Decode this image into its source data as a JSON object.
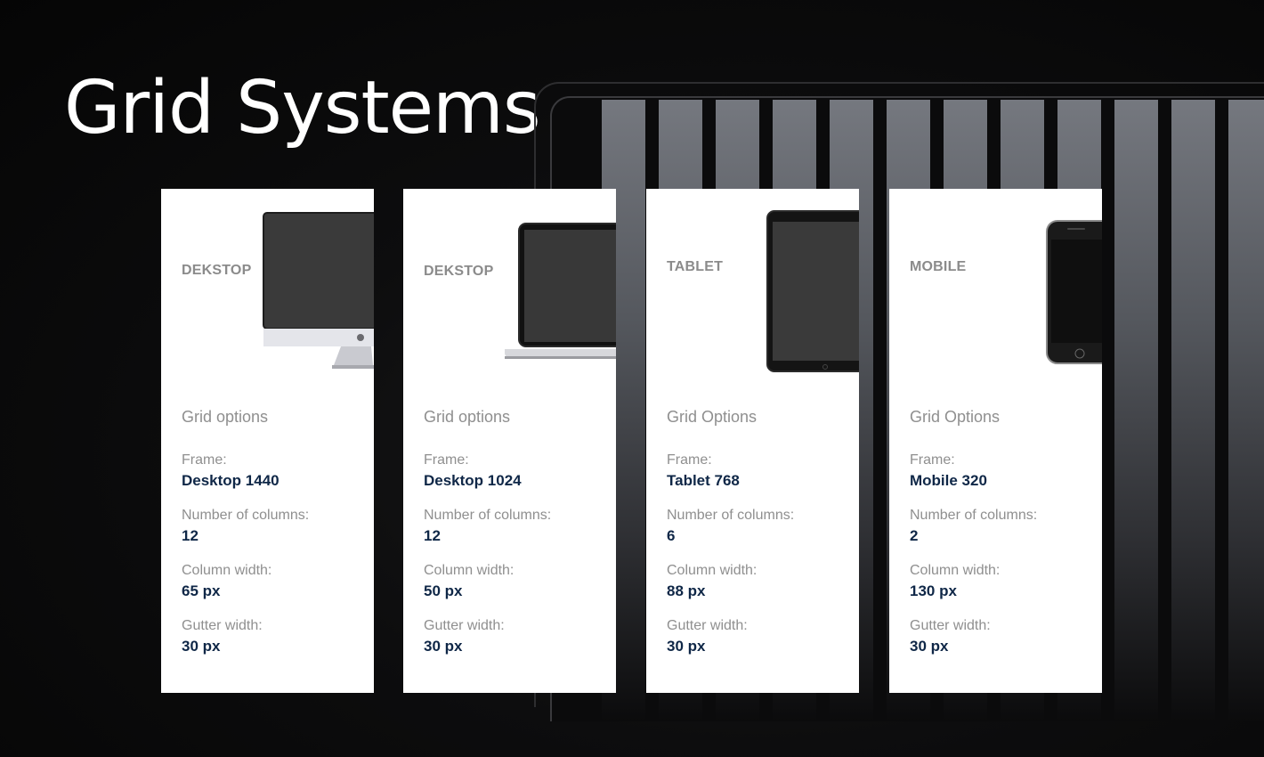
{
  "title": "Grid Systems",
  "colors": {
    "background": "#0b0b0c",
    "card": "#ffffff",
    "value_text": "#0f2747",
    "label_text": "#8f8f8f"
  },
  "cards": [
    {
      "device": "DEKSTOP",
      "device_icon": "imac-icon",
      "options_title": "Grid options",
      "frame_label": "Frame:",
      "frame_value": "Desktop 1440",
      "columns_label": "Number of columns:",
      "columns_value": "12",
      "column_width_label": "Column width:",
      "column_width_value": "65 px",
      "gutter_label": "Gutter width:",
      "gutter_value": "30 px"
    },
    {
      "device": "DEKSTOP",
      "device_icon": "laptop-icon",
      "options_title": "Grid options",
      "frame_label": "Frame:",
      "frame_value": "Desktop 1024",
      "columns_label": "Number of columns:",
      "columns_value": "12",
      "column_width_label": "Column width:",
      "column_width_value": "50 px",
      "gutter_label": "Gutter width:",
      "gutter_value": "30 px"
    },
    {
      "device": "TABLET",
      "device_icon": "tablet-icon",
      "options_title": "Grid Options",
      "frame_label": "Frame:",
      "frame_value": "Tablet 768",
      "columns_label": "Number of columns:",
      "columns_value": "6",
      "column_width_label": "Column width:",
      "column_width_value": "88 px",
      "gutter_label": "Gutter width:",
      "gutter_value": "30 px"
    },
    {
      "device": "MOBILE",
      "device_icon": "phone-icon",
      "options_title": "Grid Options",
      "frame_label": "Frame:",
      "frame_value": "Mobile 320",
      "columns_label": "Number of columns:",
      "columns_value": "2",
      "column_width_label": "Column width:",
      "column_width_value": "130 px",
      "gutter_label": "Gutter width:",
      "gutter_value": "30 px"
    }
  ]
}
